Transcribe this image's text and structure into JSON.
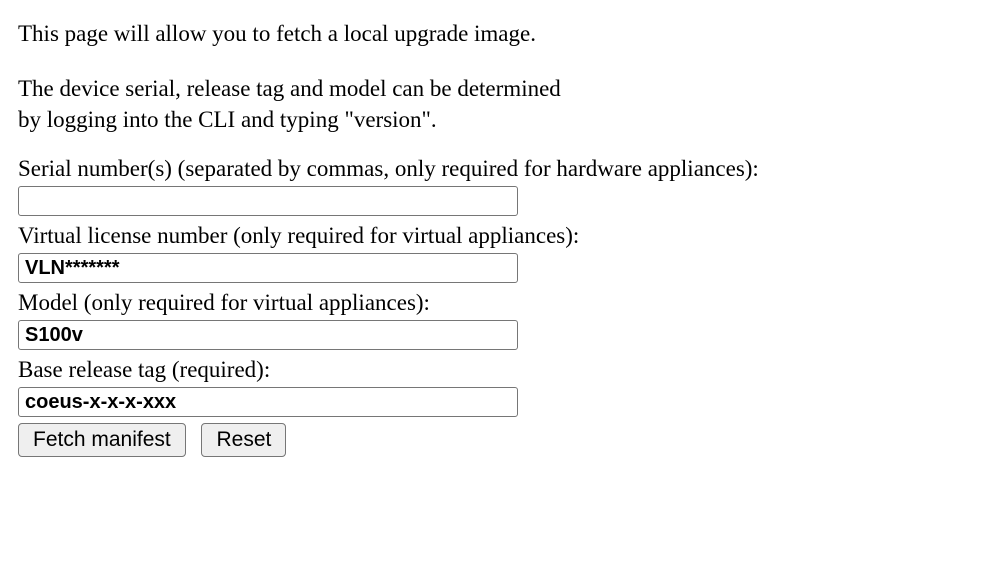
{
  "intro": "This page will allow you to fetch a local upgrade image.",
  "help_line1": "The device serial, release tag and model can be determined",
  "help_line2": "by logging into the CLI and typing \"version\".",
  "fields": {
    "serial": {
      "label": "Serial number(s) (separated by commas, only required for hardware appliances):",
      "value": ""
    },
    "vln": {
      "label": "Virtual license number (only required for virtual appliances):",
      "value": "VLN*******"
    },
    "model": {
      "label": "Model (only required for virtual appliances):",
      "value": "S100v"
    },
    "release": {
      "label": "Base release tag (required):",
      "value": "coeus-x-x-x-xxx"
    }
  },
  "buttons": {
    "fetch": "Fetch manifest",
    "reset": "Reset"
  }
}
